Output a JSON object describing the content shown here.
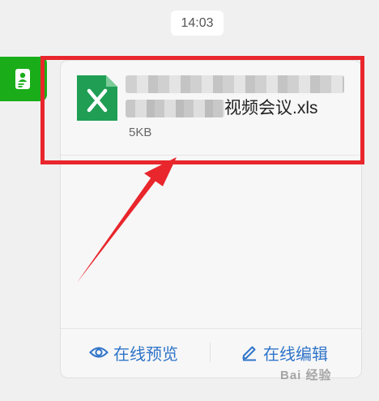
{
  "chat": {
    "timestamp": "14:03"
  },
  "file_card": {
    "file_name_visible": "视频会议.xls",
    "file_size": "5KB",
    "file_icon": "excel-file-icon",
    "actions": {
      "preview_label": "在线预览",
      "preview_icon": "eye-icon",
      "edit_label": "在线编辑",
      "edit_icon": "pencil-icon"
    }
  },
  "colors": {
    "avatar_green": "#1aad19",
    "excel_green": "#1f9e54",
    "action_blue": "#2f74c9",
    "annotation_red": "#e8262c",
    "background": "#f0f0f0"
  },
  "watermark": "Bai 经验"
}
